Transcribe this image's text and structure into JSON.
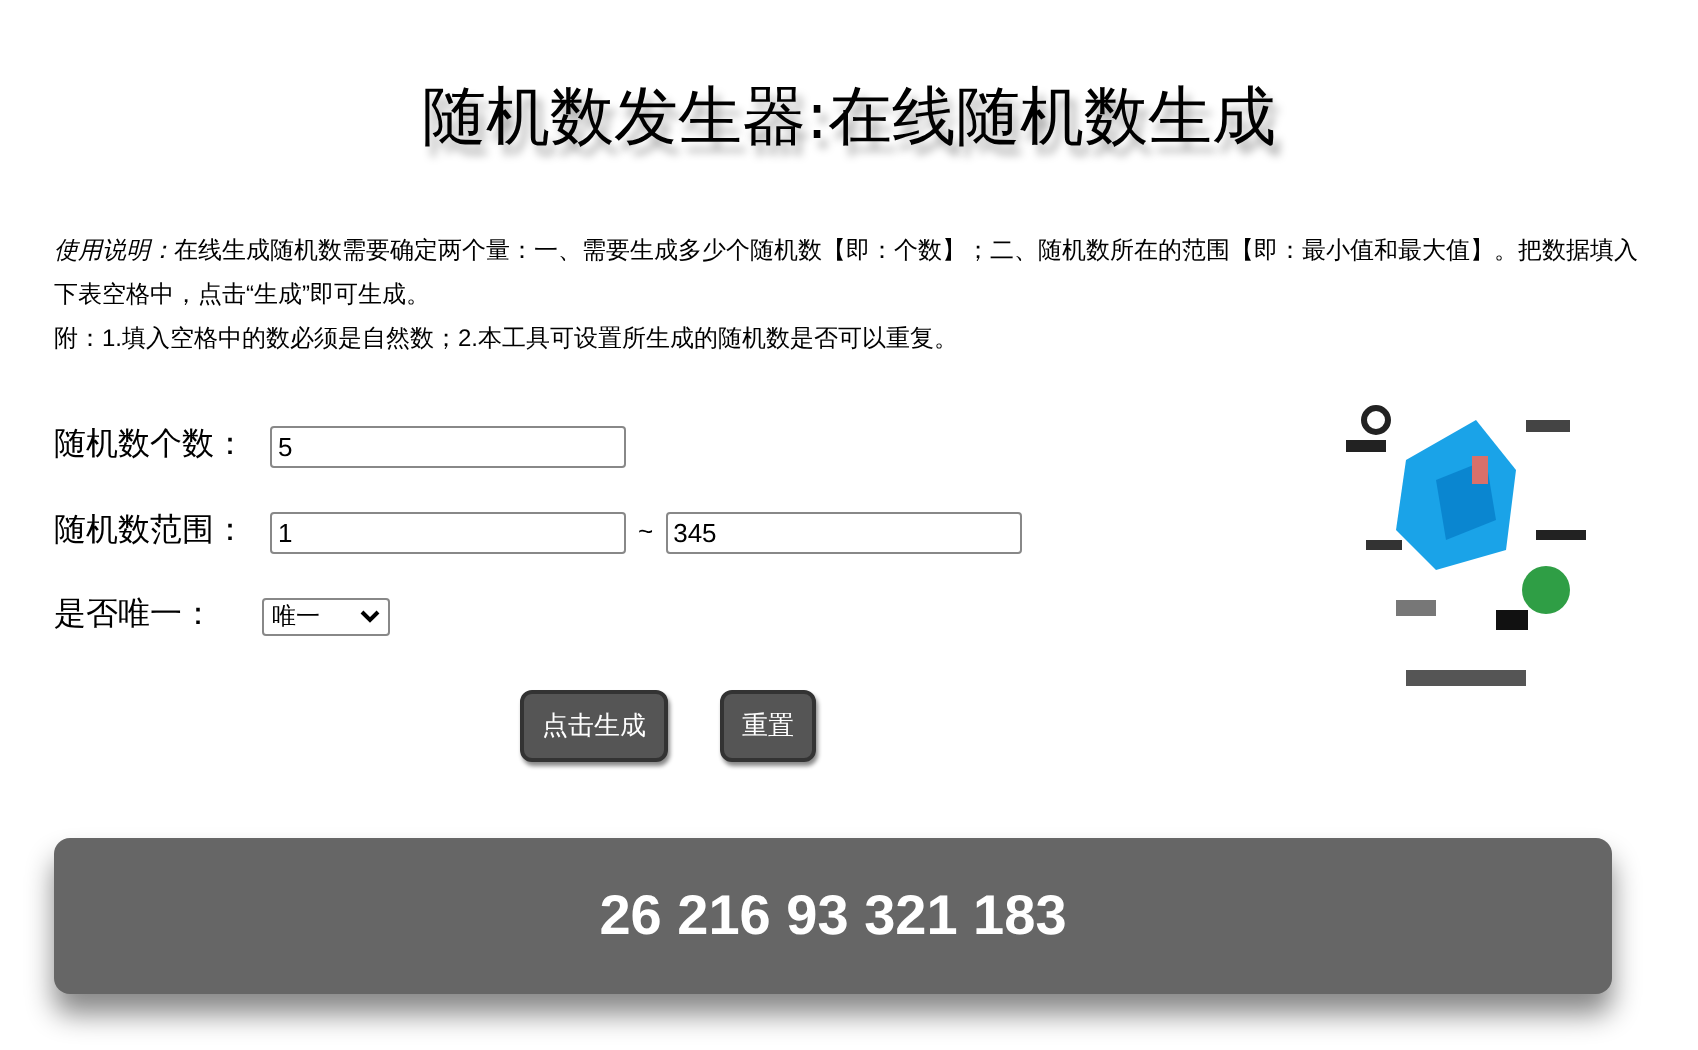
{
  "title": "随机数发生器:在线随机数生成",
  "usage": {
    "lead": "使用说明：",
    "text": "在线生成随机数需要确定两个量：一、需要生成多少个随机数【即：个数】；二、随机数所在的范围【即：最小值和最大值】。把数据填入下表空格中，点击“生成”即可生成。"
  },
  "note": "附：1.填入空格中的数必须是自然数；2.本工具可设置所生成的随机数是否可以重复。",
  "count": {
    "label": "随机数个数：",
    "value": "5"
  },
  "range": {
    "label": "随机数范围：",
    "min": "1",
    "separator": "~",
    "max": "345"
  },
  "unique": {
    "label": "是否唯一：",
    "value": "唯一"
  },
  "buttons": [
    "点击生成",
    "重置"
  ],
  "result": "26 216 93 321 183"
}
